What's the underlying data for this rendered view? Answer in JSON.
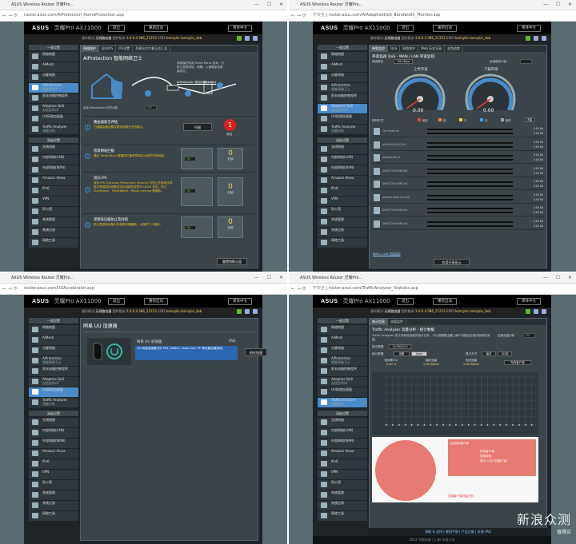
{
  "panels": [
    {
      "title": "ASUS Wireless Router 灵耀Pro...",
      "url": "router.asus.com/AiProtection_HomeProtection.asp"
    },
    {
      "title": "ASUS Wireless Router 灵耀Pro...",
      "url": "router.asus.com/AiAdaptiveQoS_Bandwidth_Monitor.asp",
      "insecure": "不安全"
    },
    {
      "title": "ASUS Wireless Router 灵耀Pro...",
      "url": "router.asus.com/UUAccelerator.asp"
    },
    {
      "title": "ASUS Wireless Router 灵耀Pro...",
      "url": "router.asus.com/TrafficAnalyzer_Statistic.asp",
      "insecure": "不安全"
    }
  ],
  "banner": {
    "logo": "ASUS",
    "model": "灵耀Pro AX11000",
    "logout": "退出",
    "reboot": "重新启动",
    "lang": "简体中文"
  },
  "info": {
    "op_label": "操作模式:",
    "mode": "无线路由器",
    "fw_label": "固件版本:",
    "fw": "3.0.0.4.386_21253",
    "ssid_label": "SSID:",
    "ssid": "tomsylie tomsylie_dxb",
    "app": "App"
  },
  "sidebar": {
    "general": "一般设置",
    "items": [
      "网络地图",
      "AiMesh",
      "访客网络",
      "AiProtection",
      "家长电脑控制程序",
      "Adaptive QoS",
      "UU网游加速器",
      "Traffic Analyzer"
    ],
    "subs": {
      "AiProtection": "智能网络卫士",
      "家长电脑控制程序": "",
      "Adaptive QoS": "自适应QoS",
      "Traffic Analyzer": "流量分析"
    },
    "advanced": "高级设置",
    "adv_items": [
      "无线网络",
      "内部网络(LAN)",
      "外部网络(WAN)",
      "Amazon Alexa",
      "IPv6",
      "VPN",
      "防火墙",
      "系统管理",
      "系统记录",
      "网络工具"
    ]
  },
  "p1": {
    "tabs": [
      "网络保护",
      "双向IPS",
      "IPS设置",
      "恶意站点拦截日志汇总"
    ],
    "title": "AiProtection 智能网络卫士",
    "desc": "网络保护采用 Trend Micro 技术，可防止恶意网站、病毒、入侵程序及黑客攻击。",
    "faq": "AiProtection 常见问题 & FAQ",
    "enable_label": "启用 AiProtection 防护功能",
    "toggle": "OFF",
    "rows": [
      {
        "num": "1",
        "title": "路由器安全评估",
        "desc": "扫描路由器设置并提供改善安全的建议。",
        "btn": "扫描",
        "risk": "1",
        "risk_label": "危险"
      },
      {
        "num": "2",
        "title": "恶意网站拦截",
        "desc": "通过 Trend Micro 数据库拦截恶意网站以保护您的网络。",
        "tog": "ON",
        "count": "0",
        "count_label": "封锁"
      },
      {
        "num": "3",
        "title": "双向 IPS",
        "desc": "双向 IPS (Intrusion Prevention System) 可防止外部攻击并阻止受感染的设备发送垃圾邮件或进行 DDoS 攻击，防止 Shellshock、Heartbleed、Bitcoin mining 等威胁。",
        "tog": "ON",
        "count": "0",
        "count_label": "封锁"
      },
      {
        "num": "4",
        "title": "受感染设备防止及封锁",
        "desc": "防止受感染设备与外部服务器通信，以保护个人隐私。",
        "tog": "ON",
        "count": "0",
        "count_label": "封锁"
      }
    ],
    "footer_btn": "重置到默认值"
  },
  "p2": {
    "tabs": [
      "带宽监控",
      "QoS",
      "网络保护",
      "Web 历史记录",
      "封包追踪"
    ],
    "title": "带宽监视 QoS - WAN / LAN 带宽监控",
    "sub_label": "网页单位",
    "sub_val": "100 Mbps",
    "right_label": "应用程序分析",
    "up_label": "上传带宽",
    "down_label": "下载带宽",
    "up_val": "0.00",
    "down_val": "0.00",
    "legend": [
      "最高",
      "高",
      "中",
      "低",
      "最低"
    ],
    "legend_colors": [
      "#e04040",
      "#f08030",
      "#f0d040",
      "#40a0e0",
      "#a0a0a0"
    ],
    "sort_label": "排列方式",
    "sort_val": "流量",
    "devices": [
      {
        "name": "Ceii Heart 4x",
        "up": "0.00 Kb",
        "down": "0.00 Kb"
      },
      {
        "name": "ac:56:00:04:32:00",
        "up": "0.00 Kb",
        "down": "0.00 Kb"
      },
      {
        "name": "android-dea-4",
        "up": "0.00 Kb",
        "down": "0.00 Kb"
      },
      {
        "name": "DESKTOP-UHM0LNE",
        "up": "0.00 Kb",
        "down": "0.00 Kb"
      },
      {
        "name": "DESKTOP-UHM0LNE",
        "up": "0.00 Kb",
        "down": "0.00 Kb"
      },
      {
        "name": "android-dbac-41-fcab",
        "up": "0.00 Kb",
        "down": "0.00 Kb"
      },
      {
        "name": "DESKTOP-UHM0LNE",
        "up": "0.00 Kb",
        "down": "0.00 Kb"
      },
      {
        "name": "DESKTOP-UHM0LNE",
        "up": "0.00 Kb",
        "down": "0.00 Kb"
      }
    ],
    "bottom_link": "WAN / LAN 流量监控",
    "bottom_btn": "应用不再显示"
  },
  "p3": {
    "title": "网易 UU 加速器",
    "sub": "网易 UU 加速器",
    "desc": "UU 网游加速器可为 PS4, Switch, Xbox One, PC 等设备加速游戏。",
    "faq": "FAQ",
    "btn": "前往加速"
  },
  "p4": {
    "tabs": [
      "统计信息",
      "流量监控"
    ],
    "title": "Traffic Analyzer 流量分析 - 统计数据",
    "desc": "Traffic Analyzer 用于对网络流量的统计分析，可以观察路由器上每个设备及应用所使用的流量。",
    "enable_label": "启用流量分析",
    "toggle": "ON",
    "date_label": "显示数据",
    "date": "11/30/2022",
    "stat_label": "统计数据",
    "stat_tabs": [
      "设备",
      "Apps"
    ],
    "show_label": "显示方式",
    "show_val": "每天",
    "range_val": "5分钟",
    "cols": [
      {
        "k": "使用率(%)",
        "v": "0.00 %"
      },
      {
        "k": "接收流量",
        "v": "0.00 Bytes"
      },
      {
        "k": "传送流量",
        "v": "0.00 Bytes"
      }
    ],
    "dev_label": "所有客户端",
    "legend": "已连线的客户端",
    "pie_label": "顶端客户端流量分析",
    "legend_items": [
      "所有客户端",
      "其他未知",
      "显示 0 位已知客户端"
    ],
    "footer": [
      "帮助 & 支持",
      "使用手册",
      "产品注册",
      "反馈"
    ],
    "faq": "FAQ",
    "copyright": "2022 华硕电脑 (上海) 有限公司"
  },
  "watermark": {
    "text": "新浪众测",
    "sub": "值得买"
  }
}
